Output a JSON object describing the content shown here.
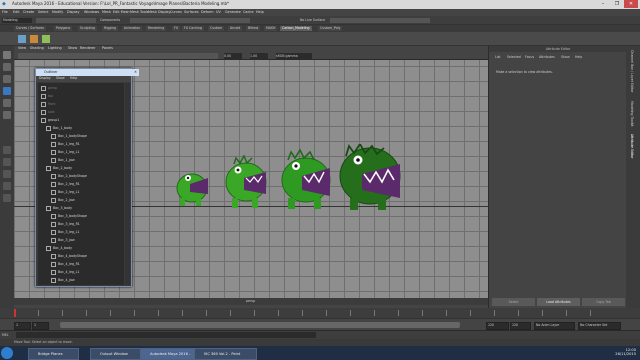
{
  "window": {
    "title": "Autodesk Maya 2016 - Educational Version: F:\\Lol_PR_Fantastic Voyage\\Image Planes\\Bacteria Modeling.mb*",
    "controls": [
      "–",
      "❐",
      "✕"
    ]
  },
  "menubar": {
    "items": [
      "File",
      "Edit",
      "Create",
      "Select",
      "Modify",
      "Display",
      "Windows",
      "Mesh",
      "Edit Mesh",
      "Mesh Tools",
      "Mesh Display",
      "Curves",
      "Surfaces",
      "Deform",
      "UV",
      "Generate",
      "Cache",
      "Help"
    ]
  },
  "statusline": {
    "mode": "Modeling",
    "components_label": "Components",
    "live_surface": "No Live Surface"
  },
  "shelf": {
    "tabs": [
      "Curves / Surfaces",
      "Polygons",
      "Sculpting",
      "Rigging",
      "Animation",
      "Rendering",
      "FX",
      "FX Caching",
      "Custom",
      "Arnold",
      "Bifrost",
      "MASH",
      "Carbon_Modeling",
      "Custom_Poly"
    ],
    "active_tab": "Carbon_Modeling"
  },
  "panel": {
    "menu": [
      "View",
      "Shading",
      "Lighting",
      "Show",
      "Renderer",
      "Panels"
    ],
    "gamma_value": "0.00",
    "gamma_scale": "1.00",
    "colorspace": "sRGB gamma",
    "camera_label": "persp"
  },
  "outliner": {
    "title": "Outliner",
    "menu": [
      "Display",
      "Show",
      "Help"
    ],
    "rows": [
      {
        "label": "persp",
        "dim": true,
        "indent": 0
      },
      {
        "label": "top",
        "dim": true,
        "indent": 0
      },
      {
        "label": "front",
        "dim": true,
        "indent": 0
      },
      {
        "label": "side",
        "dim": true,
        "indent": 0
      },
      {
        "label": "group1",
        "dim": false,
        "indent": 0
      },
      {
        "label": "Bac_1_body",
        "dim": false,
        "indent": 1
      },
      {
        "label": "Bac_1_bodyShape",
        "dim": false,
        "indent": 2
      },
      {
        "label": "Bac_1_leg_R1",
        "dim": false,
        "indent": 2
      },
      {
        "label": "Bac_1_leg_L1",
        "dim": false,
        "indent": 2
      },
      {
        "label": "Bac_1_jaw",
        "dim": false,
        "indent": 2
      },
      {
        "label": "Bac_2_body",
        "dim": false,
        "indent": 1
      },
      {
        "label": "Bac_2_bodyShape",
        "dim": false,
        "indent": 2
      },
      {
        "label": "Bac_2_leg_R1",
        "dim": false,
        "indent": 2
      },
      {
        "label": "Bac_2_leg_L1",
        "dim": false,
        "indent": 2
      },
      {
        "label": "Bac_2_jaw",
        "dim": false,
        "indent": 2
      },
      {
        "label": "Bac_3_body",
        "dim": false,
        "indent": 1
      },
      {
        "label": "Bac_3_bodyShape",
        "dim": false,
        "indent": 2
      },
      {
        "label": "Bac_3_leg_R1",
        "dim": false,
        "indent": 2
      },
      {
        "label": "Bac_3_leg_L1",
        "dim": false,
        "indent": 2
      },
      {
        "label": "Bac_3_jaw",
        "dim": false,
        "indent": 2
      },
      {
        "label": "Bac_4_body",
        "dim": false,
        "indent": 1
      },
      {
        "label": "Bac_4_bodyShape",
        "dim": false,
        "indent": 2
      },
      {
        "label": "Bac_4_leg_R1",
        "dim": false,
        "indent": 2
      },
      {
        "label": "Bac_4_leg_L1",
        "dim": false,
        "indent": 2
      },
      {
        "label": "Bac_4_jaw",
        "dim": false,
        "indent": 2
      }
    ]
  },
  "viewport": {
    "footer_label": "persp"
  },
  "attribute_editor": {
    "title": "Attribute Editor",
    "tabs": [
      "List",
      "Selected",
      "Focus",
      "Attributes",
      "Show",
      "Help"
    ],
    "message": "Make a selection to view attributes.",
    "buttons": [
      "Select",
      "Load Attributes",
      "Copy Tab"
    ]
  },
  "side_tabs": [
    "Channel Box / Layer Editor",
    "Modeling Toolkit",
    "Attribute Editor"
  ],
  "range": {
    "start": "1",
    "inner_start": "1",
    "current": "120",
    "inner_end": "120",
    "end": "200",
    "anim_layer": "No Anim Layer",
    "char_set": "No Character Set"
  },
  "commandline": {
    "lang": "MEL"
  },
  "helpline": {
    "text": "Move Tool: Select an object to move."
  },
  "taskbar": {
    "items": [
      "Bridge Planes",
      "Output Window",
      "Autodesk Maya 2016 -",
      "ISC 360 Vol.2 - Paint"
    ],
    "clock_time": "12:00",
    "clock_date": "26/11/2015"
  },
  "colors": {
    "accent": "#cfe0f5",
    "bacteria_green": "#3aa826",
    "bacteria_dark": "#1f6b1a",
    "mouth_purple": "#5a2a6a"
  }
}
